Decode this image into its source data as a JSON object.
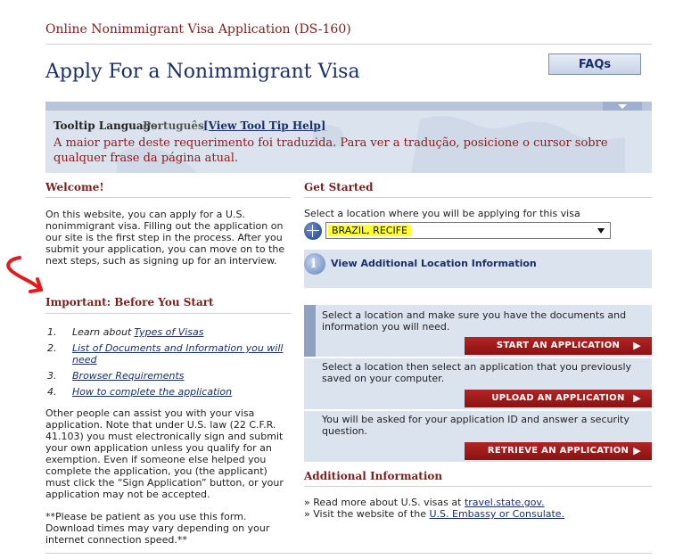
{
  "app_title": "Online Nonimmigrant Visa Application (DS-160)",
  "page_title": "Apply For a Nonimmigrant Visa",
  "faq_label": "FAQs",
  "tooltip": {
    "label": "Tooltip Language:",
    "language": "Português",
    "help_link": "[View Tool Tip Help]",
    "message": "A maior parte deste requerimento foi traduzida. Para ver a tradução, posicione o cursor sobre qualquer frase da página atual."
  },
  "welcome": {
    "heading": "Welcome!",
    "text": "On this website, you can apply for a U.S. nonimmigrant visa. Filling out the application on our site is the first step in the process. After you submit your application, you can move on to the next steps, such as signing up for an interview."
  },
  "important": {
    "heading": "Important: Before You Start",
    "items": [
      {
        "num": "1.",
        "prefix": "Learn about ",
        "link": "Types of Visas"
      },
      {
        "num": "2.",
        "prefix": "",
        "link": "List of Documents and Information you will need"
      },
      {
        "num": "3.",
        "prefix": "",
        "link": "Browser Requirements"
      },
      {
        "num": "4.",
        "prefix": "",
        "link": "How to complete the application"
      }
    ],
    "text": "Other people can assist you with your visa application. Note that under U.S. law (22 C.F.R. 41.103) you must electronically sign and submit your own application unless you qualify for an exemption. Even if someone else helped you complete the application, you (the applicant) must click the “Sign Application” button, or your application may not be accepted.",
    "note": "**Please be patient as you use this form. Download times may vary depending on your internet connection speed.**"
  },
  "get_started": {
    "heading": "Get Started",
    "prompt": "Select a location where you will be applying for this visa",
    "selected_location": "BRAZIL, RECIFE",
    "additional_location_link": "View Additional Location Information"
  },
  "actions": [
    {
      "text": "Select a location and make sure you have the documents and information you will need.",
      "button": "START AN APPLICATION"
    },
    {
      "text": "Select a location then select an application that you previously saved on your computer.",
      "button": "UPLOAD AN APPLICATION"
    },
    {
      "text": "You will be asked for your application ID and answer a security question.",
      "button": "RETRIEVE AN APPLICATION"
    }
  ],
  "additional_info": {
    "heading": "Additional Information",
    "line1_prefix": "» Read more about U.S. visas at ",
    "line1_link": "travel.state.gov.",
    "line2_prefix": "» Visit the website of the ",
    "line2_link": "U.S. Embassy or Consulate."
  },
  "colors": {
    "maroon": "#7a1f1f",
    "navy": "#1a2f66",
    "panel": "#dbe3ef",
    "button_red": "#a01c1c",
    "highlight": "#ffff33"
  }
}
